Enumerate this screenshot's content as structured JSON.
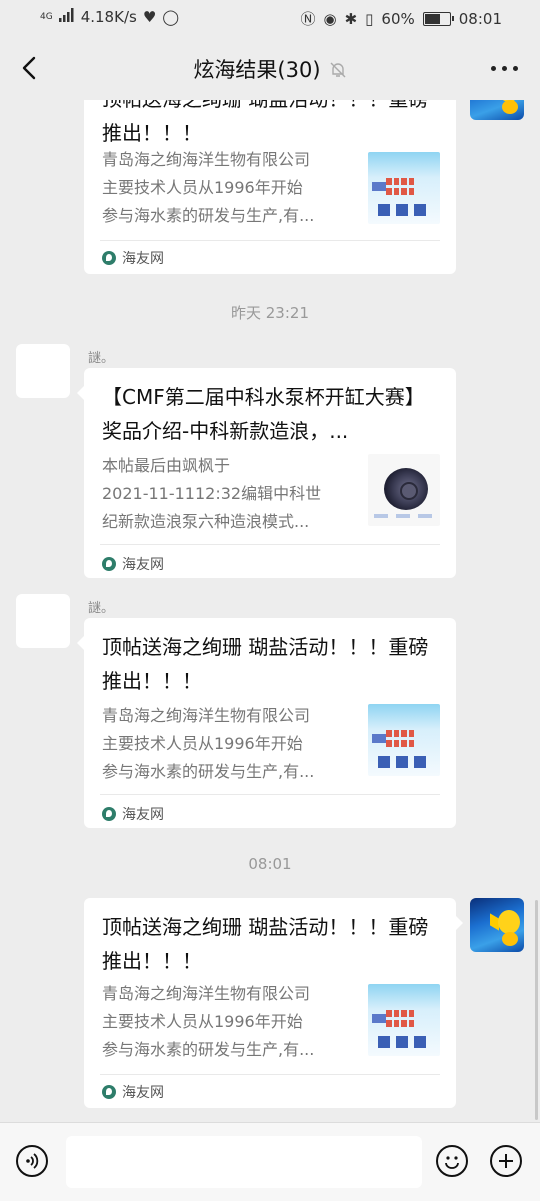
{
  "status": {
    "network": "4G",
    "speed": "4.18K/s",
    "battery": "60%",
    "time": "08:01"
  },
  "nav": {
    "title": "炫海结果(30)"
  },
  "timestamps": [
    "昨天 23:21",
    "08:01"
  ],
  "messages": [
    {
      "title": "顶帖送海之绚珊 瑚盐活动！！！重磅推出！！！",
      "desc": [
        "青岛海之绚海洋生物有限公司",
        "主要技术人员从1996年开始",
        "参与海水素的研发与生产,有..."
      ],
      "source": "海友网"
    },
    {
      "nick": "謎。",
      "title": "【CMF第二届中科水泵杯开缸大赛】奖品介绍-中科新款造浪，...",
      "desc": [
        "本帖最后由飒枫于",
        "2021-11-1112:32编辑中科世",
        "纪新款造浪泵六种造浪模式..."
      ],
      "source": "海友网"
    },
    {
      "nick": "謎。",
      "title": "顶帖送海之绚珊 瑚盐活动！！！重磅推出！！！",
      "desc": [
        "青岛海之绚海洋生物有限公司",
        "主要技术人员从1996年开始",
        "参与海水素的研发与生产,有..."
      ],
      "source": "海友网"
    },
    {
      "title": "顶帖送海之绚珊 瑚盐活动！！！重磅推出！！！",
      "desc": [
        "青岛海之绚海洋生物有限公司",
        "主要技术人员从1996年开始",
        "参与海水素的研发与生产,有..."
      ],
      "source": "海友网"
    }
  ],
  "icons": {
    "back": "back-chevron-icon",
    "mute": "bell-off-icon",
    "more": "more-dots-icon",
    "voice": "voice-icon",
    "emoji": "emoji-icon",
    "plus": "plus-icon"
  }
}
